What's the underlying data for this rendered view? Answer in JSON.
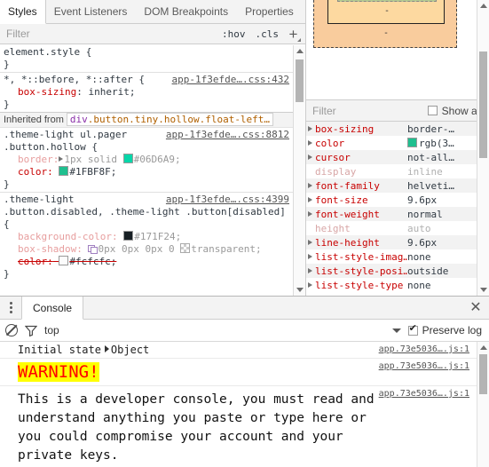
{
  "devtools": {
    "top_tabs": [
      {
        "label": "Styles",
        "selected": true
      },
      {
        "label": "Event Listeners",
        "selected": false
      },
      {
        "label": "DOM Breakpoints",
        "selected": false
      },
      {
        "label": "Properties",
        "selected": false
      }
    ],
    "styles_toolbar": {
      "filter_placeholder": "Filter",
      "hov_label": ":hov",
      "cls_label": ".cls",
      "new_rule_label": "+"
    },
    "styles_rules": [
      {
        "selector": "element.style",
        "open_brace": " {",
        "close_brace": "}",
        "origin": "",
        "declarations": []
      },
      {
        "selector": "*, *::before, *::after",
        "open_brace": " {",
        "close_brace": "}",
        "origin": "app-1f3efde….css:432",
        "declarations": [
          {
            "property": "box-sizing",
            "value": "inherit;"
          }
        ]
      }
    ],
    "inherited": {
      "label": "Inherited from",
      "chip_tag": "div",
      "chip_classes": ".button.tiny.hollow.float-left…"
    },
    "inherited_rules": [
      {
        "selector_line1": ".theme-light ul.pager",
        "selector_line2": ".button.hollow {",
        "origin": "app-1f3efde….css:8812",
        "close_brace": "}",
        "declarations": [
          {
            "property": "border:",
            "value": "1px solid",
            "color_value": "#06D6A9;",
            "swatch": "#06D6A9",
            "inactive": true,
            "has_triangle": true
          },
          {
            "property": "color:",
            "value": "",
            "color_value": "#1FBF8F;",
            "swatch": "#1FBF8F",
            "inactive": false,
            "has_triangle": false
          }
        ]
      },
      {
        "selector_line1": ".theme-light",
        "selector_line2": ".button.disabled,",
        "selector_line2b": ".theme-light .button[disabled]",
        "selector_line3": "{",
        "origin": "app-1f3efde….css:4399",
        "close_brace": "}",
        "declarations": [
          {
            "property": "background-color:",
            "color_value": "#171F24;",
            "swatch": "#171F24",
            "inactive": true
          },
          {
            "property": "box-shadow:",
            "value": "0px 0px 0px 0",
            "extra": "transparent;",
            "inactive": true
          },
          {
            "property": "color:",
            "color_value": "#fcfcfc;",
            "swatch": "#fcfcfc",
            "struck": true
          }
        ]
      }
    ],
    "computed_filter": {
      "filter_placeholder": "Filter",
      "show_all_label": "Show all",
      "show_all_checked": false
    },
    "box_model": {
      "margin_value": "-",
      "border_value": "-",
      "padding_value": "-"
    },
    "computed_properties": [
      {
        "name": "box-sizing",
        "value": "border-…",
        "expandable": true,
        "greyed": false
      },
      {
        "name": "color",
        "value": "rgb(3…",
        "swatch": "#1FBF8F",
        "expandable": true,
        "greyed": false
      },
      {
        "name": "cursor",
        "value": "not-all…",
        "expandable": true,
        "greyed": false
      },
      {
        "name": "display",
        "value": "inline",
        "expandable": false,
        "greyed": true
      },
      {
        "name": "font-family",
        "value": "helveti…",
        "expandable": true,
        "greyed": false
      },
      {
        "name": "font-size",
        "value": "9.6px",
        "expandable": true,
        "greyed": false
      },
      {
        "name": "font-weight",
        "value": "normal",
        "expandable": true,
        "greyed": false
      },
      {
        "name": "height",
        "value": "auto",
        "expandable": false,
        "greyed": true
      },
      {
        "name": "line-height",
        "value": "9.6px",
        "expandable": true,
        "greyed": false
      },
      {
        "name": "list-style-imag…",
        "value": "none",
        "expandable": true,
        "greyed": false
      },
      {
        "name": "list-style-posi…",
        "value": "outside",
        "expandable": true,
        "greyed": false
      },
      {
        "name": "list-style-type",
        "value": "none",
        "expandable": true,
        "greyed": false
      }
    ]
  },
  "console": {
    "tab_label": "Console",
    "close_label": "✕",
    "toolbar": {
      "clear_icon": "ban-icon",
      "filter_icon": "funnel-icon",
      "context": "top",
      "preserve_log_label": "Preserve log",
      "preserve_log_checked": true
    },
    "messages": [
      {
        "type": "log",
        "text": "Initial state",
        "object_label": "Object",
        "source": "app.73e5036….js:1"
      },
      {
        "type": "warning",
        "text": "WARNING!",
        "source": "app.73e5036….js:1"
      },
      {
        "type": "big",
        "text": "This is a developer console, you must read and understand anything you paste or type here or you could compromise your account and your private keys.",
        "source": "app.73e5036….js:1"
      }
    ]
  },
  "colors": {
    "accent_blue": "#3b78e7",
    "warning_bg": "#ffff00",
    "warning_fg": "#ff0000",
    "property_red": "#c80000",
    "teal_border": "#06D6A9",
    "teal_color": "#1FBF8F"
  }
}
